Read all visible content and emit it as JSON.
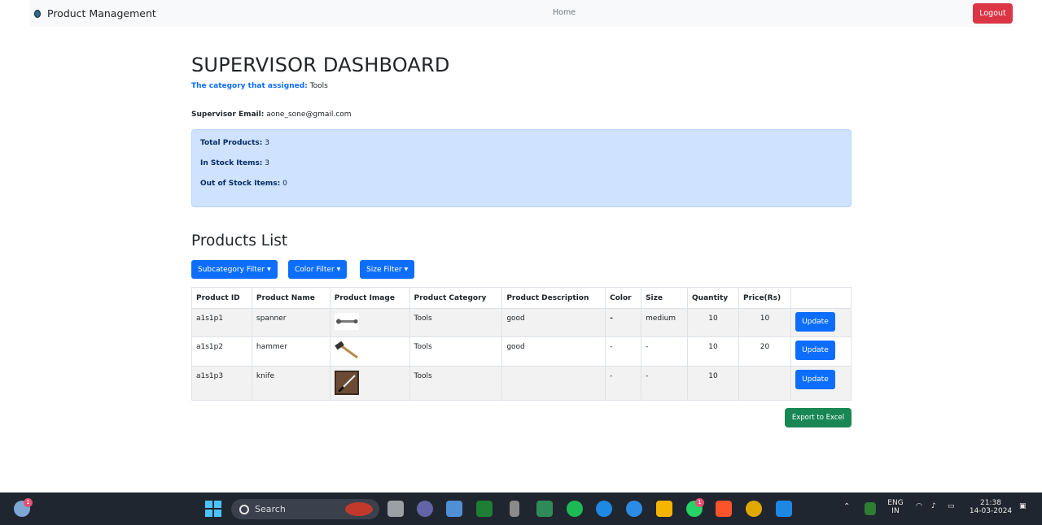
{
  "navbar": {
    "brand": "Product Management",
    "home_link": "Home",
    "logout_label": "Logout"
  },
  "dashboard": {
    "title": "SUPERVISOR DASHBOARD",
    "category_label": "The category that assigned:",
    "category_value": "Tools",
    "email_label": "Supervisor Email:",
    "email_value": "aone_sone@gmail.com"
  },
  "stats": {
    "total_label": "Total Products:",
    "total_value": "3",
    "instock_label": "In Stock Items:",
    "instock_value": "3",
    "outstock_label": "Out of Stock Items:",
    "outstock_value": "0"
  },
  "products": {
    "title": "Products List",
    "filters": {
      "subcategory": "Subcategory Filter",
      "color": "Color Filter",
      "size": "Size Filter"
    },
    "columns": [
      "Product ID",
      "Product Name",
      "Product Image",
      "Product Category",
      "Product Description",
      "Color",
      "Size",
      "Quantity",
      "Price(Rs)",
      ""
    ],
    "rows": [
      {
        "id": "a1s1p1",
        "name": "spanner",
        "image": "spanner-image",
        "category": "Tools",
        "description": "good",
        "color": "-",
        "size": "medium",
        "quantity": "10",
        "price": "10",
        "action": "Update"
      },
      {
        "id": "a1s1p2",
        "name": "hammer",
        "image": "hammer-image",
        "category": "Tools",
        "description": "good",
        "color": "-",
        "size": "-",
        "quantity": "10",
        "price": "20",
        "action": "Update"
      },
      {
        "id": "a1s1p3",
        "name": "knife",
        "image": "knife-image",
        "category": "Tools",
        "description": "",
        "color": "-",
        "size": "-",
        "quantity": "10",
        "price": "",
        "action": "Update"
      }
    ],
    "export_label": "Export to Excel"
  },
  "taskbar": {
    "search_placeholder": "Search",
    "lang_top": "ENG",
    "lang_bottom": "IN",
    "time": "21:38",
    "date": "14-03-2024",
    "weather_badge": "1",
    "whatsapp_badge": "1"
  },
  "colors": {
    "primary": "#0d6efd",
    "danger": "#dc3545",
    "success": "#198754",
    "info_bg": "#cfe2ff"
  }
}
